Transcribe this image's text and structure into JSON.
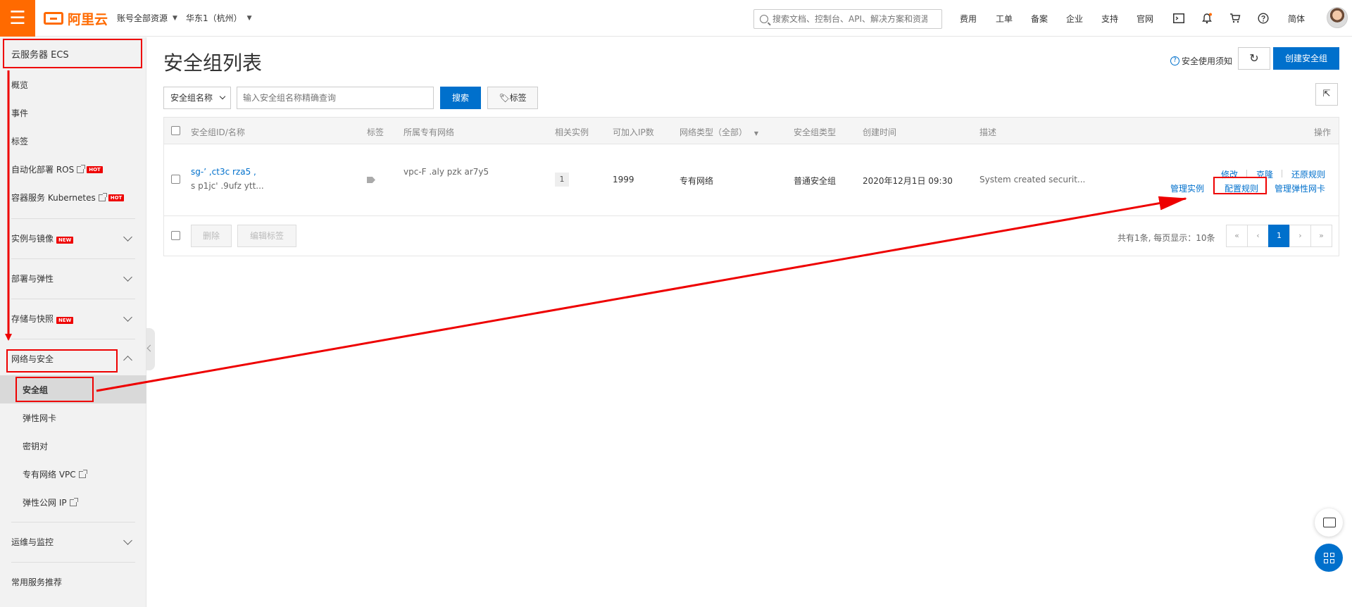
{
  "topbar": {
    "logo_text": "阿里云",
    "account_scope": "账号全部资源",
    "region": "华东1（杭州）",
    "search_placeholder": "搜索文档、控制台、API、解决方案和资源",
    "links": [
      "费用",
      "工单",
      "备案",
      "企业",
      "支持",
      "官网"
    ],
    "language": "简体"
  },
  "sidebar": {
    "title": "云服务器 ECS",
    "items": [
      {
        "label": "概览"
      },
      {
        "label": "事件"
      },
      {
        "label": "标签"
      },
      {
        "label": "自动化部署 ROS",
        "badge": "HOT"
      },
      {
        "label": "容器服务 Kubernetes",
        "badge": "HOT"
      }
    ],
    "groups": [
      {
        "label": "实例与镜像",
        "badge": "NEW"
      },
      {
        "label": "部署与弹性"
      },
      {
        "label": "存储与快照",
        "badge": "NEW"
      },
      {
        "label": "网络与安全"
      }
    ],
    "network_children": [
      "安全组",
      "弹性网卡",
      "密钥对",
      "专有网络 VPC",
      "弹性公网 IP"
    ],
    "bottom_groups": [
      "运维与监控",
      "常用服务推荐"
    ]
  },
  "main": {
    "title": "安全组列表",
    "notice": "安全使用须知",
    "create_button": "创建安全组",
    "filter": {
      "select_value": "安全组名称",
      "input_placeholder": "输入安全组名称精确查询",
      "search_button": "搜索",
      "tag_button": "标签"
    },
    "columns": [
      "安全组ID/名称",
      "标签",
      "所属专有网络",
      "相关实例",
      "可加入IP数",
      "网络类型（全部）",
      "安全组类型",
      "创建时间",
      "描述",
      "操作"
    ],
    "rows": [
      {
        "id_line1": "sg-’  ,ct3c   rza5   ,",
        "id_line2": "s     p1jc'    .9ufz   ytt...",
        "vpc": "vpc-F    .aly    pzk    ar7y5",
        "instances": "1",
        "ip_count": "1999",
        "network_type": "专有网络",
        "sg_type": "普通安全组",
        "created": "2020年12月1日 09:30",
        "description": "System created securit...",
        "actions_row1": [
          "修改",
          "克隆",
          "还原规则"
        ],
        "actions_row2": [
          "管理实例",
          "配置规则",
          "管理弹性网卡"
        ]
      }
    ],
    "footer": {
      "delete_button": "删除",
      "edit_tags_button": "编辑标签",
      "summary": "共有1条, 每页显示：10条",
      "pages": [
        "«",
        "‹",
        "1",
        "›",
        "»"
      ]
    }
  },
  "colors": {
    "brand": "#ff6a00",
    "primary": "#0070cc",
    "annotation": "#e00000"
  }
}
